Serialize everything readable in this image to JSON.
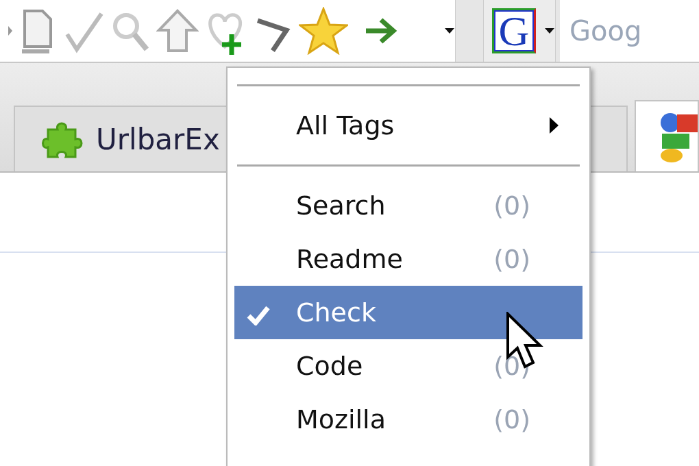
{
  "search_engine": {
    "logo": "G",
    "placeholder": "Goog"
  },
  "tabs": [
    {
      "label": "UrlbarEx",
      "selected": false
    },
    {
      "selected": true
    }
  ],
  "menu": {
    "items": [
      {
        "kind": "separator"
      },
      {
        "kind": "submenu",
        "label": "All Tags"
      },
      {
        "kind": "separator"
      },
      {
        "kind": "tag",
        "label": "Search",
        "count": "(0)",
        "checked": false,
        "selected": false
      },
      {
        "kind": "tag",
        "label": "Readme",
        "count": "(0)",
        "checked": false,
        "selected": false
      },
      {
        "kind": "tag",
        "label": "Check",
        "checked": true,
        "selected": true
      },
      {
        "kind": "tag",
        "label": "Code",
        "count": "(0)",
        "checked": false,
        "selected": false
      },
      {
        "kind": "tag",
        "label": "Mozilla",
        "count": "(0)",
        "checked": false,
        "selected": false
      }
    ]
  }
}
